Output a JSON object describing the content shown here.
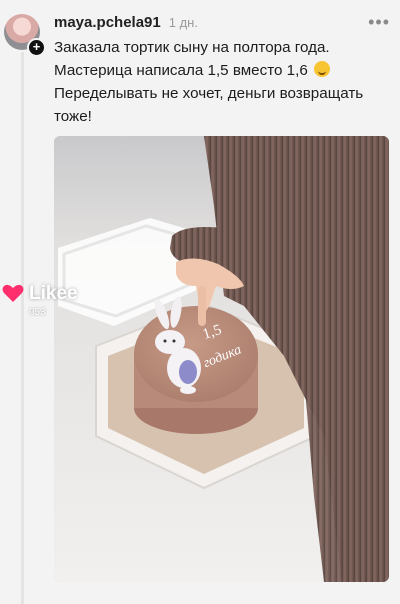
{
  "post": {
    "username": "maya.pchela91",
    "time": "1 дн.",
    "more_label": "•••",
    "add_label": "+",
    "text_line1": "Заказала тортик сыну на полтора года.",
    "text_line2": "Мастерица написала 1,5 вместо 1,6",
    "text_line3": "Переделывать не хочет, деньги возвращать",
    "text_line4": "тоже!",
    "emoji": "grin-sweat-emoji"
  },
  "photo": {
    "cake_text_line1": "1,5",
    "cake_text_line2": "годика"
  },
  "watermark": {
    "brand": "Likee",
    "id": "953",
    "color": "#ff2f6d"
  }
}
